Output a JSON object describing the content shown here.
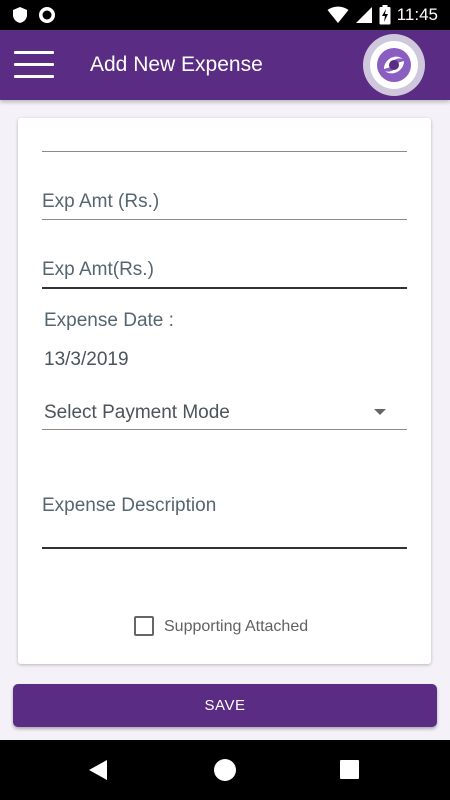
{
  "status_bar": {
    "time": "11:45"
  },
  "app_bar": {
    "title": "Add New Expense"
  },
  "form": {
    "first_field_value": "",
    "exp_amount_placeholder": "Exp Amt (Rs.)",
    "exp_amount2_placeholder": "Exp Amt(Rs.)",
    "expense_date_label": "Expense Date :",
    "expense_date_value": "13/3/2019",
    "payment_mode_selected": "Select Payment Mode",
    "description_placeholder": "Expense Description",
    "supporting_checkbox_label": "Supporting Attached",
    "supporting_checked": false
  },
  "actions": {
    "save_label": "SAVE"
  },
  "colors": {
    "primary": "#5b2c83",
    "background": "#f4f2f8"
  }
}
